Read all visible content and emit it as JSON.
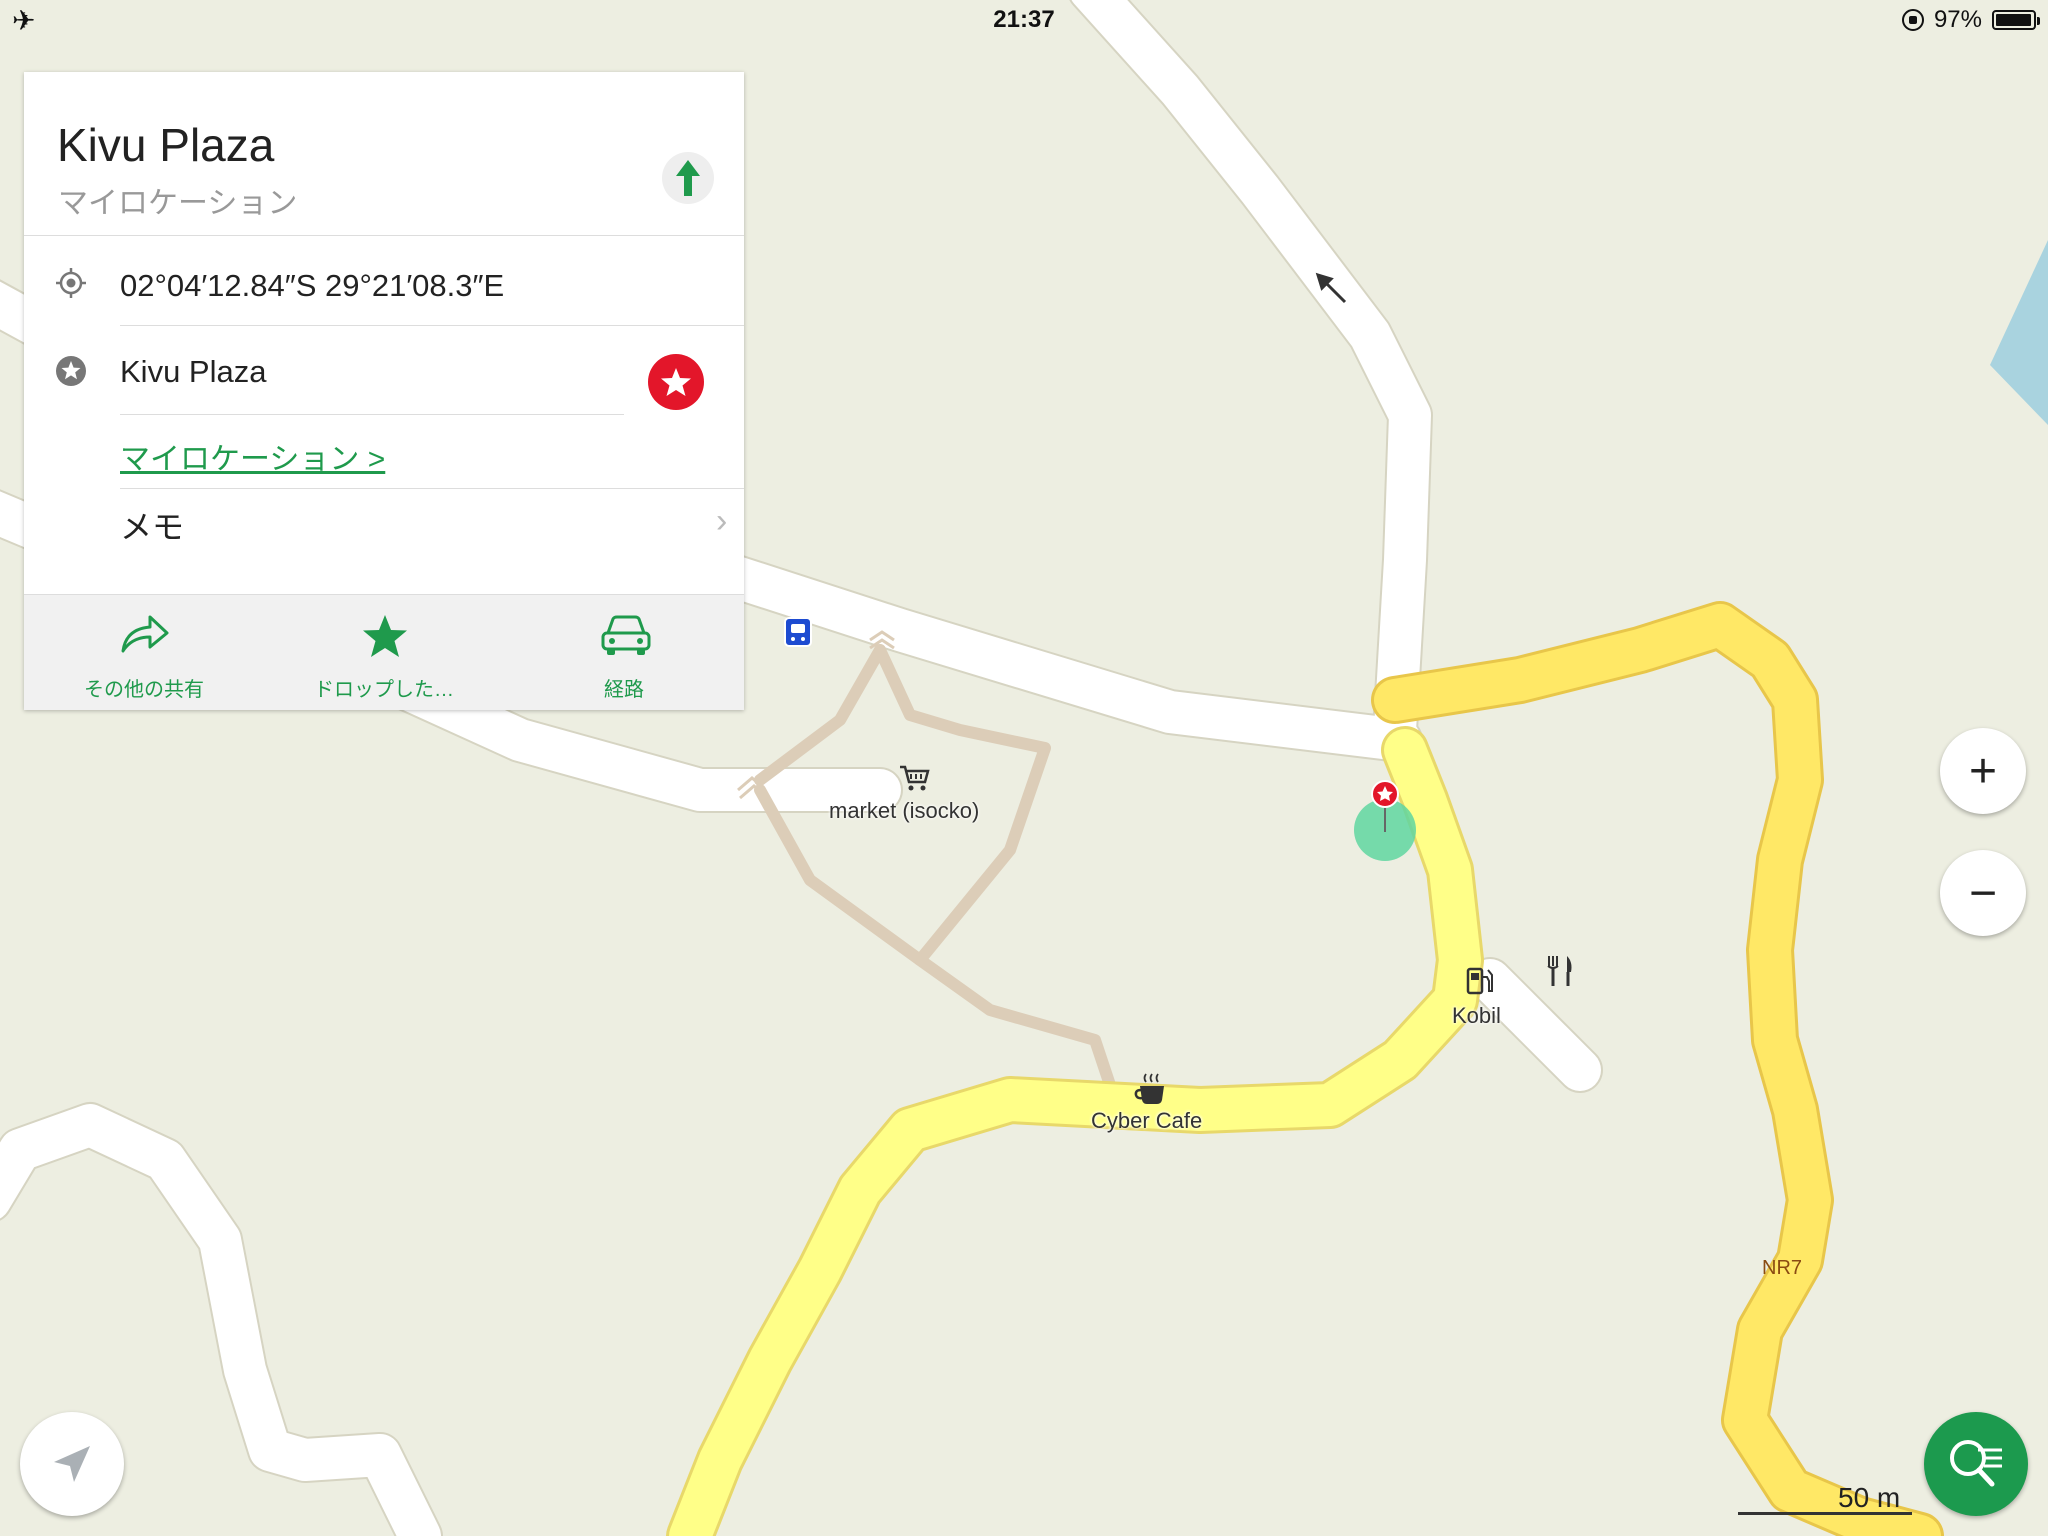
{
  "status_bar": {
    "time": "21:37",
    "battery_text": "97%",
    "battery_level": 0.97,
    "icons": [
      "airplane-icon",
      "rotation-lock-icon",
      "battery-icon"
    ]
  },
  "place_card": {
    "title": "Kivu Plaza",
    "subtitle": "マイロケーション",
    "coordinates": "02°04′12.84″S 29°21′08.3″E",
    "name": "Kivu Plaza",
    "group_link": "マイロケーション >",
    "memo_label": "メモ",
    "actions": [
      {
        "label": "その他の共有",
        "icon": "share-arrow-icon"
      },
      {
        "label": "ドロップした…",
        "icon": "star-icon"
      },
      {
        "label": "経路",
        "icon": "car-icon"
      }
    ],
    "accent_color": "#1f9a4c",
    "favorite_color": "#e3162a"
  },
  "map": {
    "labels": {
      "market": "market (isocko)",
      "kobil": "Kobil",
      "cafe": "Cyber Cafe",
      "road": "NR7"
    },
    "colors": {
      "background": "#edeee1",
      "road_white": "#ffffff",
      "road_primary": "#ffe866",
      "road_secondary": "#ffff88",
      "path": "#dccdb8",
      "water": "#a9d3df"
    }
  },
  "controls": {
    "zoom_in": "+",
    "zoom_out": "−",
    "scale": "50 m"
  }
}
